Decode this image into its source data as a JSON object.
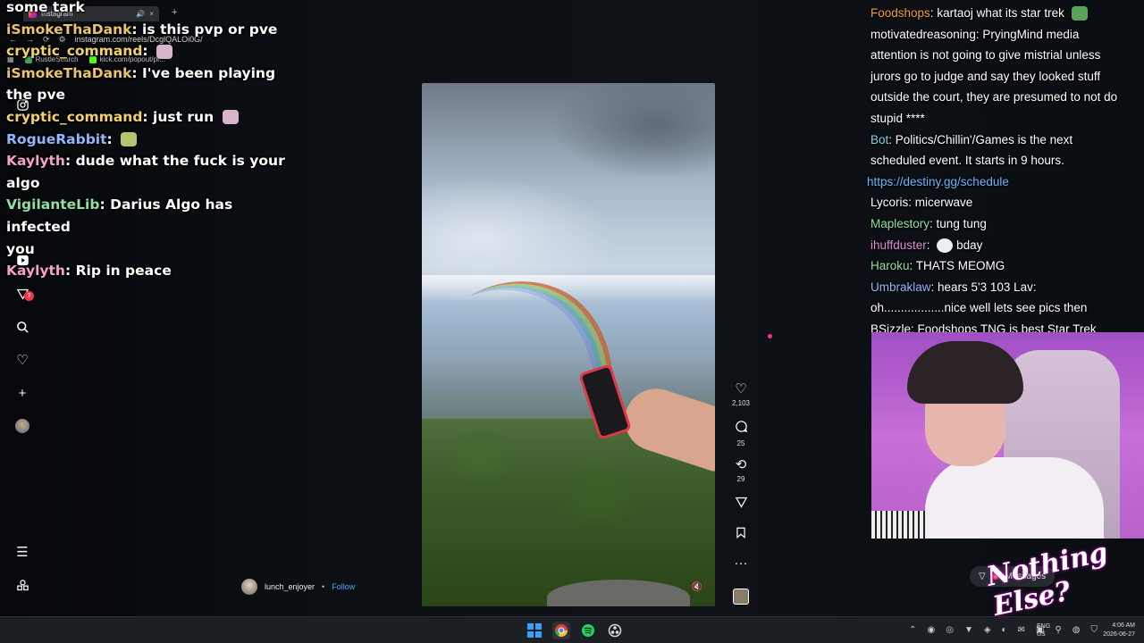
{
  "browser": {
    "tab_title": "Instagram",
    "tab_close": "×",
    "tab_audio": "🔊",
    "new_tab": "+",
    "url": "instagram.com/reels/DcglQALOi0G/",
    "bookmarks": [
      {
        "label": "RustleSearch",
        "color": "#3aa55c"
      },
      {
        "label": "kick.com/popout/pr...",
        "color": "#53fc18"
      }
    ]
  },
  "chat_left": [
    {
      "user": "some tark",
      "user_color": "#ffffff",
      "text": ""
    },
    {
      "user": "iSmokeThaDank",
      "user_color": "#e9c46a",
      "text": "is this pvp or pve"
    },
    {
      "user": "cryptic_command",
      "user_color": "#f2d16b",
      "text": "",
      "emote": true
    },
    {
      "user": "iSmokeThaDank",
      "user_color": "#e9c46a",
      "text": "I've been playing"
    },
    {
      "user": "",
      "user_color": "#ffffff",
      "text": "the pve"
    },
    {
      "user": "cryptic_command",
      "user_color": "#f2d16b",
      "text": "just run",
      "emote": true
    },
    {
      "user": "RogueRabbit",
      "user_color": "#8fb8ff",
      "text": "",
      "emote": true
    },
    {
      "user": "Kaylyth",
      "user_color": "#f4a3c7",
      "text": "dude what the fuck is your"
    },
    {
      "user": "",
      "user_color": "#ffffff",
      "text": "algo"
    },
    {
      "user": "VigilanteLib",
      "user_color": "#8fe0a1",
      "text": "Darius Algo has infected"
    },
    {
      "user": "",
      "user_color": "#ffffff",
      "text": "you"
    },
    {
      "user": "Kaylyth",
      "user_color": "#f4a3c7",
      "text": "Rip in peace"
    }
  ],
  "sidebar": {
    "notification_count": "3"
  },
  "video": {
    "mute": "🔇",
    "likes": "2,103",
    "comments": "25",
    "reposts": "29",
    "more": "···"
  },
  "author": {
    "name": "lunch_enjoyer",
    "separator": "•",
    "follow": "Follow"
  },
  "chat_right": [
    {
      "user": "Foodshops",
      "user_color": "#f29c38",
      "text": "kartaoj what its star trek"
    },
    {
      "user": "motivatedreasoning",
      "user_color": "#ffffff",
      "text": "PryingMind media attention is not going to give mistrial unless jurors go to judge and say they looked stuff outside the court, they are presumed to not do stupid ****"
    },
    {
      "user": "Bot",
      "user_color": "#7fd8e8",
      "text": "Politics/Chillin'/Games is the next scheduled event. It starts in 9 hours."
    },
    {
      "user": "",
      "user_color": "#ffffff",
      "text": "https://destiny.gg/schedule",
      "link": true
    },
    {
      "user": "Lycoris",
      "user_color": "#ffffff",
      "text": "micerwave"
    },
    {
      "user": "Maplestory",
      "user_color": "#8fe0a1",
      "text": "tung tung"
    },
    {
      "user": "ihuffduster",
      "user_color": "#e58bd8",
      "text": "bday"
    },
    {
      "user": "Haroku",
      "user_color": "#8fe0a1",
      "text": "THATS MEOMG"
    },
    {
      "user": "Umbraklaw",
      "user_color": "#8fb8ff",
      "text": "hears 5'3 103 Lav: oh..................nice well lets see pics then"
    },
    {
      "user": "BSizzle",
      "user_color": "#ffffff",
      "text": "Foodshops TNG is best Star Trek"
    }
  ],
  "message_chip": {
    "label": "Messages",
    "count": "3"
  },
  "logo_text": "Nothing Else?",
  "taskbar": {
    "lang": "ENG",
    "region": "US",
    "time": "4:06 AM",
    "date": "2026-06-27"
  },
  "colors": {
    "accent_link": "#4aa3ff",
    "badge": "#ff3040"
  }
}
